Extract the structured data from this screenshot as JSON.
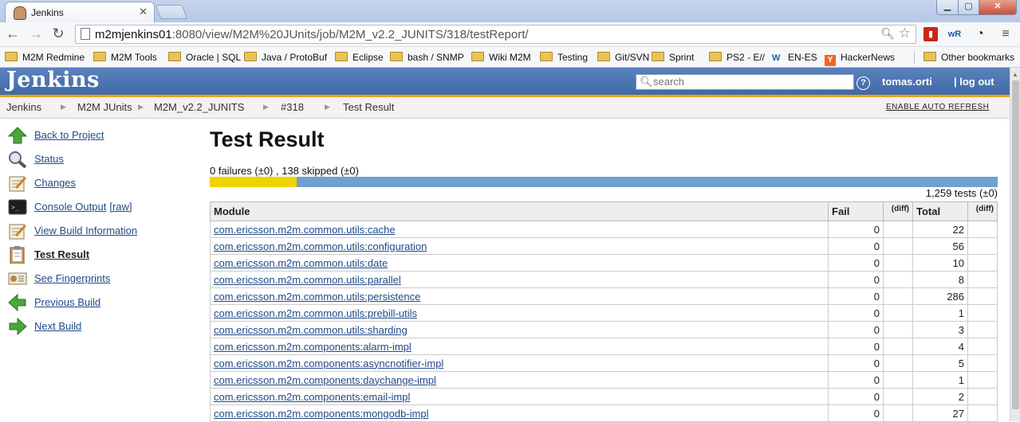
{
  "browser": {
    "tab_title": "Jenkins",
    "url_host": "m2mjenkins01",
    "url_rest": ":8080/view/M2M%20JUnits/job/M2M_v2.2_JUNITS/318/testReport/"
  },
  "bookmarks": [
    {
      "label": "M2M Redmine",
      "icon": "folder-icon"
    },
    {
      "label": "M2M Tools",
      "icon": "folder-icon"
    },
    {
      "label": "Oracle | SQL",
      "icon": "folder-icon"
    },
    {
      "label": "Java / ProtoBuf",
      "icon": "folder-icon"
    },
    {
      "label": "Eclipse",
      "icon": "folder-icon"
    },
    {
      "label": "bash / SNMP",
      "icon": "folder-icon"
    },
    {
      "label": "Wiki M2M",
      "icon": "folder-icon"
    },
    {
      "label": "Testing",
      "icon": "folder-icon"
    },
    {
      "label": "Git/SVN",
      "icon": "folder-icon"
    },
    {
      "label": "Sprint",
      "icon": "folder-icon"
    },
    {
      "label": "PS2 - E//",
      "icon": "folder-icon"
    },
    {
      "label": "EN-ES",
      "icon": "wordreference-icon"
    },
    {
      "label": "HackerNews",
      "icon": "hackernews-icon"
    },
    {
      "label": "Other bookmarks",
      "icon": "folder-icon"
    }
  ],
  "jenkins": {
    "logo": "Jenkins",
    "search_placeholder": "search",
    "user": "tomas.orti",
    "logout": "| log out"
  },
  "breadcrumb": [
    "Jenkins",
    "M2M JUnits",
    "M2M_v2.2_JUNITS",
    "#318",
    "Test Result"
  ],
  "auto_refresh": "ENABLE AUTO REFRESH",
  "side_panel": [
    {
      "label": "Back to Project",
      "icon": "up-arrow-icon"
    },
    {
      "label": "Status",
      "icon": "magnifier-icon"
    },
    {
      "label": "Changes",
      "icon": "notepad-icon"
    },
    {
      "label": "Console Output",
      "icon": "terminal-icon",
      "extra": "[raw]"
    },
    {
      "label": "View Build Information",
      "icon": "notepad-icon"
    },
    {
      "label": "Test Result",
      "icon": "clipboard-icon",
      "current": true
    },
    {
      "label": "See Fingerprints",
      "icon": "fingerprint-icon"
    },
    {
      "label": "Previous Build",
      "icon": "left-arrow-icon"
    },
    {
      "label": "Next Build",
      "icon": "right-arrow-icon"
    }
  ],
  "main": {
    "title": "Test Result",
    "summary": "0 failures (±0) , 138 skipped (±0)",
    "skipped_fraction": 0.11,
    "test_count": "1,259 tests (±0)",
    "columns": {
      "module": "Module",
      "fail": "Fail",
      "diff1": "(diff)",
      "total": "Total",
      "diff2": "(diff)"
    },
    "rows": [
      {
        "module": "com.ericsson.m2m.common.utils:cache",
        "fail": "0",
        "total": "22"
      },
      {
        "module": "com.ericsson.m2m.common.utils:configuration",
        "fail": "0",
        "total": "56"
      },
      {
        "module": "com.ericsson.m2m.common.utils:date",
        "fail": "0",
        "total": "10"
      },
      {
        "module": "com.ericsson.m2m.common.utils:parallel",
        "fail": "0",
        "total": "8"
      },
      {
        "module": "com.ericsson.m2m.common.utils:persistence",
        "fail": "0",
        "total": "286"
      },
      {
        "module": "com.ericsson.m2m.common.utils:prebill-utils",
        "fail": "0",
        "total": "1"
      },
      {
        "module": "com.ericsson.m2m.common.utils:sharding",
        "fail": "0",
        "total": "3"
      },
      {
        "module": "com.ericsson.m2m.components:alarm-impl",
        "fail": "0",
        "total": "4"
      },
      {
        "module": "com.ericsson.m2m.components:asyncnotifier-impl",
        "fail": "0",
        "total": "5"
      },
      {
        "module": "com.ericsson.m2m.components:daychange-impl",
        "fail": "0",
        "total": "1"
      },
      {
        "module": "com.ericsson.m2m.components:email-impl",
        "fail": "0",
        "total": "2"
      },
      {
        "module": "com.ericsson.m2m.components:mongodb-impl",
        "fail": "0",
        "total": "27"
      }
    ]
  }
}
